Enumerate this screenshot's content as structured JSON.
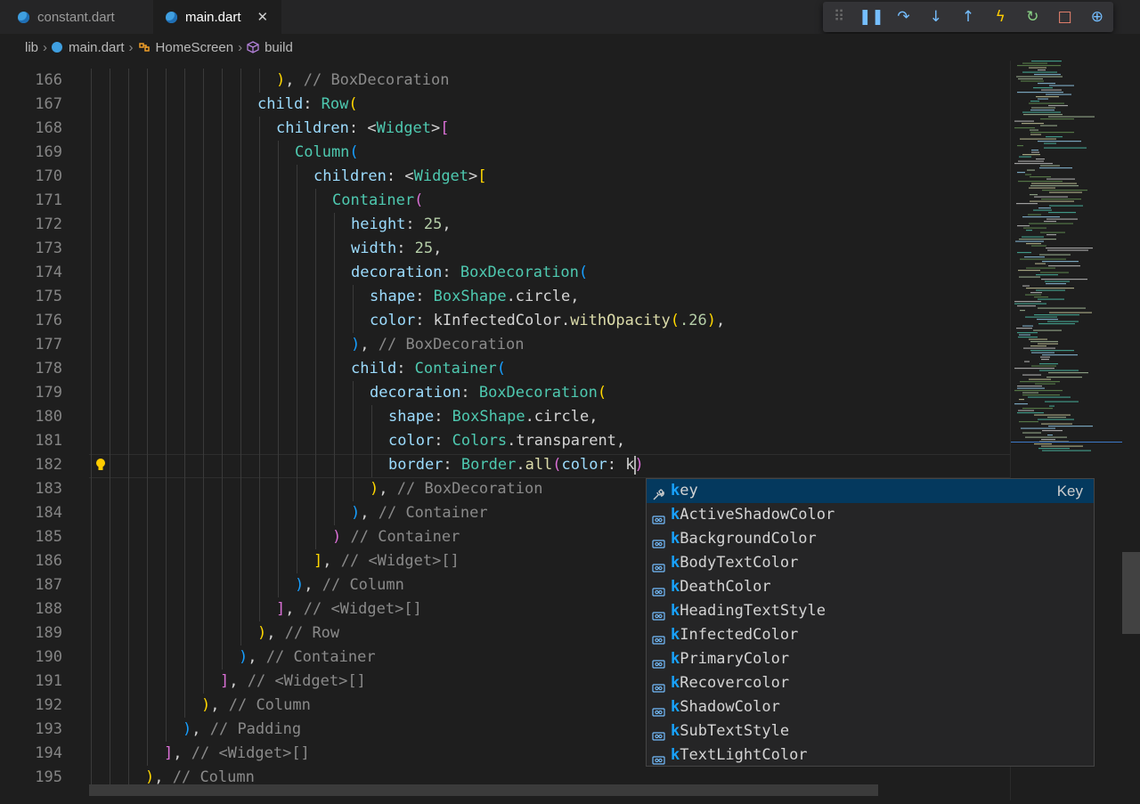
{
  "tabs": [
    {
      "label": "constant.dart",
      "active": false
    },
    {
      "label": "main.dart",
      "active": true,
      "close": "✕"
    }
  ],
  "breadcrumb": [
    "lib",
    "main.dart",
    "HomeScreen",
    "build"
  ],
  "debug_toolbar": [
    {
      "name": "grip",
      "glyph": "⠿",
      "color": "#6a6a6a"
    },
    {
      "name": "pause",
      "glyph": "❚❚",
      "color": "#75beff"
    },
    {
      "name": "step-over",
      "glyph": "↷",
      "color": "#75beff"
    },
    {
      "name": "step-into",
      "glyph": "↓",
      "color": "#75beff"
    },
    {
      "name": "step-out",
      "glyph": "↑",
      "color": "#75beff"
    },
    {
      "name": "hot-reload",
      "glyph": "ϟ",
      "color": "#ffcc00"
    },
    {
      "name": "restart",
      "glyph": "↻",
      "color": "#89d185"
    },
    {
      "name": "stop",
      "glyph": "□",
      "color": "#f48771"
    },
    {
      "name": "devtools",
      "glyph": "⊕",
      "color": "#75beff"
    }
  ],
  "editor": {
    "line_numbers": [
      "166",
      "167",
      "168",
      "169",
      "170",
      "171",
      "172",
      "173",
      "174",
      "175",
      "176",
      "177",
      "178",
      "179",
      "180",
      "181",
      "182",
      "183",
      "184",
      "185",
      "186",
      "187",
      "188",
      "189",
      "190",
      "191",
      "192",
      "193",
      "194",
      "195"
    ],
    "current_line": "182",
    "lines": [
      {
        "indent": 10,
        "tokens": [
          {
            "t": ")",
            "c": "by"
          },
          {
            "t": ", ",
            "c": "pl"
          },
          {
            "t": "// BoxDecoration",
            "c": "cm"
          }
        ]
      },
      {
        "indent": 9,
        "tokens": [
          {
            "t": "child",
            "c": "kw"
          },
          {
            "t": ": ",
            "c": "pl"
          },
          {
            "t": "Row",
            "c": "cls"
          },
          {
            "t": "(",
            "c": "by"
          }
        ]
      },
      {
        "indent": 10,
        "tokens": [
          {
            "t": "children",
            "c": "kw"
          },
          {
            "t": ": <",
            "c": "pl"
          },
          {
            "t": "Widget",
            "c": "cls"
          },
          {
            "t": ">",
            "c": "pl"
          },
          {
            "t": "[",
            "c": "bp"
          }
        ]
      },
      {
        "indent": 11,
        "tokens": [
          {
            "t": "Column",
            "c": "cls"
          },
          {
            "t": "(",
            "c": "bb"
          }
        ]
      },
      {
        "indent": 12,
        "tokens": [
          {
            "t": "children",
            "c": "kw"
          },
          {
            "t": ": <",
            "c": "pl"
          },
          {
            "t": "Widget",
            "c": "cls"
          },
          {
            "t": ">",
            "c": "pl"
          },
          {
            "t": "[",
            "c": "by"
          }
        ]
      },
      {
        "indent": 13,
        "tokens": [
          {
            "t": "Container",
            "c": "cls"
          },
          {
            "t": "(",
            "c": "bp"
          }
        ]
      },
      {
        "indent": 14,
        "tokens": [
          {
            "t": "height",
            "c": "kw"
          },
          {
            "t": ": ",
            "c": "pl"
          },
          {
            "t": "25",
            "c": "num"
          },
          {
            "t": ",",
            "c": "pl"
          }
        ]
      },
      {
        "indent": 14,
        "tokens": [
          {
            "t": "width",
            "c": "kw"
          },
          {
            "t": ": ",
            "c": "pl"
          },
          {
            "t": "25",
            "c": "num"
          },
          {
            "t": ",",
            "c": "pl"
          }
        ]
      },
      {
        "indent": 14,
        "tokens": [
          {
            "t": "decoration",
            "c": "kw"
          },
          {
            "t": ": ",
            "c": "pl"
          },
          {
            "t": "BoxDecoration",
            "c": "cls"
          },
          {
            "t": "(",
            "c": "bb"
          }
        ]
      },
      {
        "indent": 15,
        "tokens": [
          {
            "t": "shape",
            "c": "kw"
          },
          {
            "t": ": ",
            "c": "pl"
          },
          {
            "t": "BoxShape",
            "c": "cls"
          },
          {
            "t": ".circle,",
            "c": "pl"
          }
        ]
      },
      {
        "indent": 15,
        "tokens": [
          {
            "t": "color",
            "c": "kw"
          },
          {
            "t": ": kInfectedColor.",
            "c": "pl"
          },
          {
            "t": "withOpacity",
            "c": "fn"
          },
          {
            "t": "(",
            "c": "by"
          },
          {
            "t": ".26",
            "c": "num"
          },
          {
            "t": ")",
            "c": "by"
          },
          {
            "t": ",",
            "c": "pl"
          }
        ]
      },
      {
        "indent": 14,
        "tokens": [
          {
            "t": ")",
            "c": "bb"
          },
          {
            "t": ", ",
            "c": "pl"
          },
          {
            "t": "// BoxDecoration",
            "c": "cm"
          }
        ]
      },
      {
        "indent": 14,
        "tokens": [
          {
            "t": "child",
            "c": "kw"
          },
          {
            "t": ": ",
            "c": "pl"
          },
          {
            "t": "Container",
            "c": "cls"
          },
          {
            "t": "(",
            "c": "bb"
          }
        ]
      },
      {
        "indent": 15,
        "tokens": [
          {
            "t": "decoration",
            "c": "kw"
          },
          {
            "t": ": ",
            "c": "pl"
          },
          {
            "t": "BoxDecoration",
            "c": "cls"
          },
          {
            "t": "(",
            "c": "by"
          }
        ]
      },
      {
        "indent": 16,
        "tokens": [
          {
            "t": "shape",
            "c": "kw"
          },
          {
            "t": ": ",
            "c": "pl"
          },
          {
            "t": "BoxShape",
            "c": "cls"
          },
          {
            "t": ".circle,",
            "c": "pl"
          }
        ]
      },
      {
        "indent": 16,
        "tokens": [
          {
            "t": "color",
            "c": "kw"
          },
          {
            "t": ": ",
            "c": "pl"
          },
          {
            "t": "Colors",
            "c": "cls"
          },
          {
            "t": ".transparent,",
            "c": "pl"
          }
        ]
      },
      {
        "indent": 16,
        "tokens": [
          {
            "t": "border",
            "c": "kw"
          },
          {
            "t": ": ",
            "c": "pl"
          },
          {
            "t": "Border",
            "c": "cls"
          },
          {
            "t": ".",
            "c": "pl"
          },
          {
            "t": "all",
            "c": "fn"
          },
          {
            "t": "(",
            "c": "bp"
          },
          {
            "t": "color",
            "c": "kw"
          },
          {
            "t": ": k",
            "c": "pl"
          },
          {
            "t": ")",
            "c": "bp"
          }
        ]
      },
      {
        "indent": 15,
        "tokens": [
          {
            "t": ")",
            "c": "by"
          },
          {
            "t": ", ",
            "c": "pl"
          },
          {
            "t": "// BoxDecoration",
            "c": "cm"
          }
        ]
      },
      {
        "indent": 14,
        "tokens": [
          {
            "t": ")",
            "c": "bb"
          },
          {
            "t": ", ",
            "c": "pl"
          },
          {
            "t": "// Container",
            "c": "cm"
          }
        ]
      },
      {
        "indent": 13,
        "tokens": [
          {
            "t": ")",
            "c": "bp"
          },
          {
            "t": " ",
            "c": "pl"
          },
          {
            "t": "// Container",
            "c": "cm"
          }
        ]
      },
      {
        "indent": 12,
        "tokens": [
          {
            "t": "]",
            "c": "by"
          },
          {
            "t": ", ",
            "c": "pl"
          },
          {
            "t": "// <Widget>[]",
            "c": "cm"
          }
        ]
      },
      {
        "indent": 11,
        "tokens": [
          {
            "t": ")",
            "c": "bb"
          },
          {
            "t": ", ",
            "c": "pl"
          },
          {
            "t": "// Column",
            "c": "cm"
          }
        ]
      },
      {
        "indent": 10,
        "tokens": [
          {
            "t": "]",
            "c": "bp"
          },
          {
            "t": ", ",
            "c": "pl"
          },
          {
            "t": "// <Widget>[]",
            "c": "cm"
          }
        ]
      },
      {
        "indent": 9,
        "tokens": [
          {
            "t": ")",
            "c": "by"
          },
          {
            "t": ", ",
            "c": "pl"
          },
          {
            "t": "// Row",
            "c": "cm"
          }
        ]
      },
      {
        "indent": 8,
        "tokens": [
          {
            "t": ")",
            "c": "bb"
          },
          {
            "t": ", ",
            "c": "pl"
          },
          {
            "t": "// Container",
            "c": "cm"
          }
        ]
      },
      {
        "indent": 7,
        "tokens": [
          {
            "t": "]",
            "c": "bp"
          },
          {
            "t": ", ",
            "c": "pl"
          },
          {
            "t": "// <Widget>[]",
            "c": "cm"
          }
        ]
      },
      {
        "indent": 6,
        "tokens": [
          {
            "t": ")",
            "c": "by"
          },
          {
            "t": ", ",
            "c": "pl"
          },
          {
            "t": "// Column",
            "c": "cm"
          }
        ]
      },
      {
        "indent": 5,
        "tokens": [
          {
            "t": ")",
            "c": "bb"
          },
          {
            "t": ", ",
            "c": "pl"
          },
          {
            "t": "// Padding",
            "c": "cm"
          }
        ]
      },
      {
        "indent": 4,
        "tokens": [
          {
            "t": "]",
            "c": "bp"
          },
          {
            "t": ", ",
            "c": "pl"
          },
          {
            "t": "// <Widget>[]",
            "c": "cm"
          }
        ]
      },
      {
        "indent": 3,
        "tokens": [
          {
            "t": ")",
            "c": "by"
          },
          {
            "t": ", ",
            "c": "pl"
          },
          {
            "t": "// Column",
            "c": "cm"
          }
        ]
      }
    ]
  },
  "suggestions": {
    "typed": "k",
    "items": [
      {
        "label": "key",
        "detail": "Key",
        "icon": "wrench-icon",
        "selected": true
      },
      {
        "label": "kActiveShadowColor",
        "icon": "variable-icon"
      },
      {
        "label": "kBackgroundColor",
        "icon": "variable-icon"
      },
      {
        "label": "kBodyTextColor",
        "icon": "variable-icon"
      },
      {
        "label": "kDeathColor",
        "icon": "variable-icon"
      },
      {
        "label": "kHeadingTextStyle",
        "icon": "variable-icon"
      },
      {
        "label": "kInfectedColor",
        "icon": "variable-icon"
      },
      {
        "label": "kPrimaryColor",
        "icon": "variable-icon"
      },
      {
        "label": "kRecovercolor",
        "icon": "variable-icon"
      },
      {
        "label": "kShadowColor",
        "icon": "variable-icon"
      },
      {
        "label": "kSubTextStyle",
        "icon": "variable-icon"
      },
      {
        "label": "kTextLightColor",
        "icon": "variable-icon"
      }
    ]
  },
  "colors": {
    "accent": "#18a3ff",
    "selection": "#04395e",
    "background": "#1e1e1e"
  }
}
